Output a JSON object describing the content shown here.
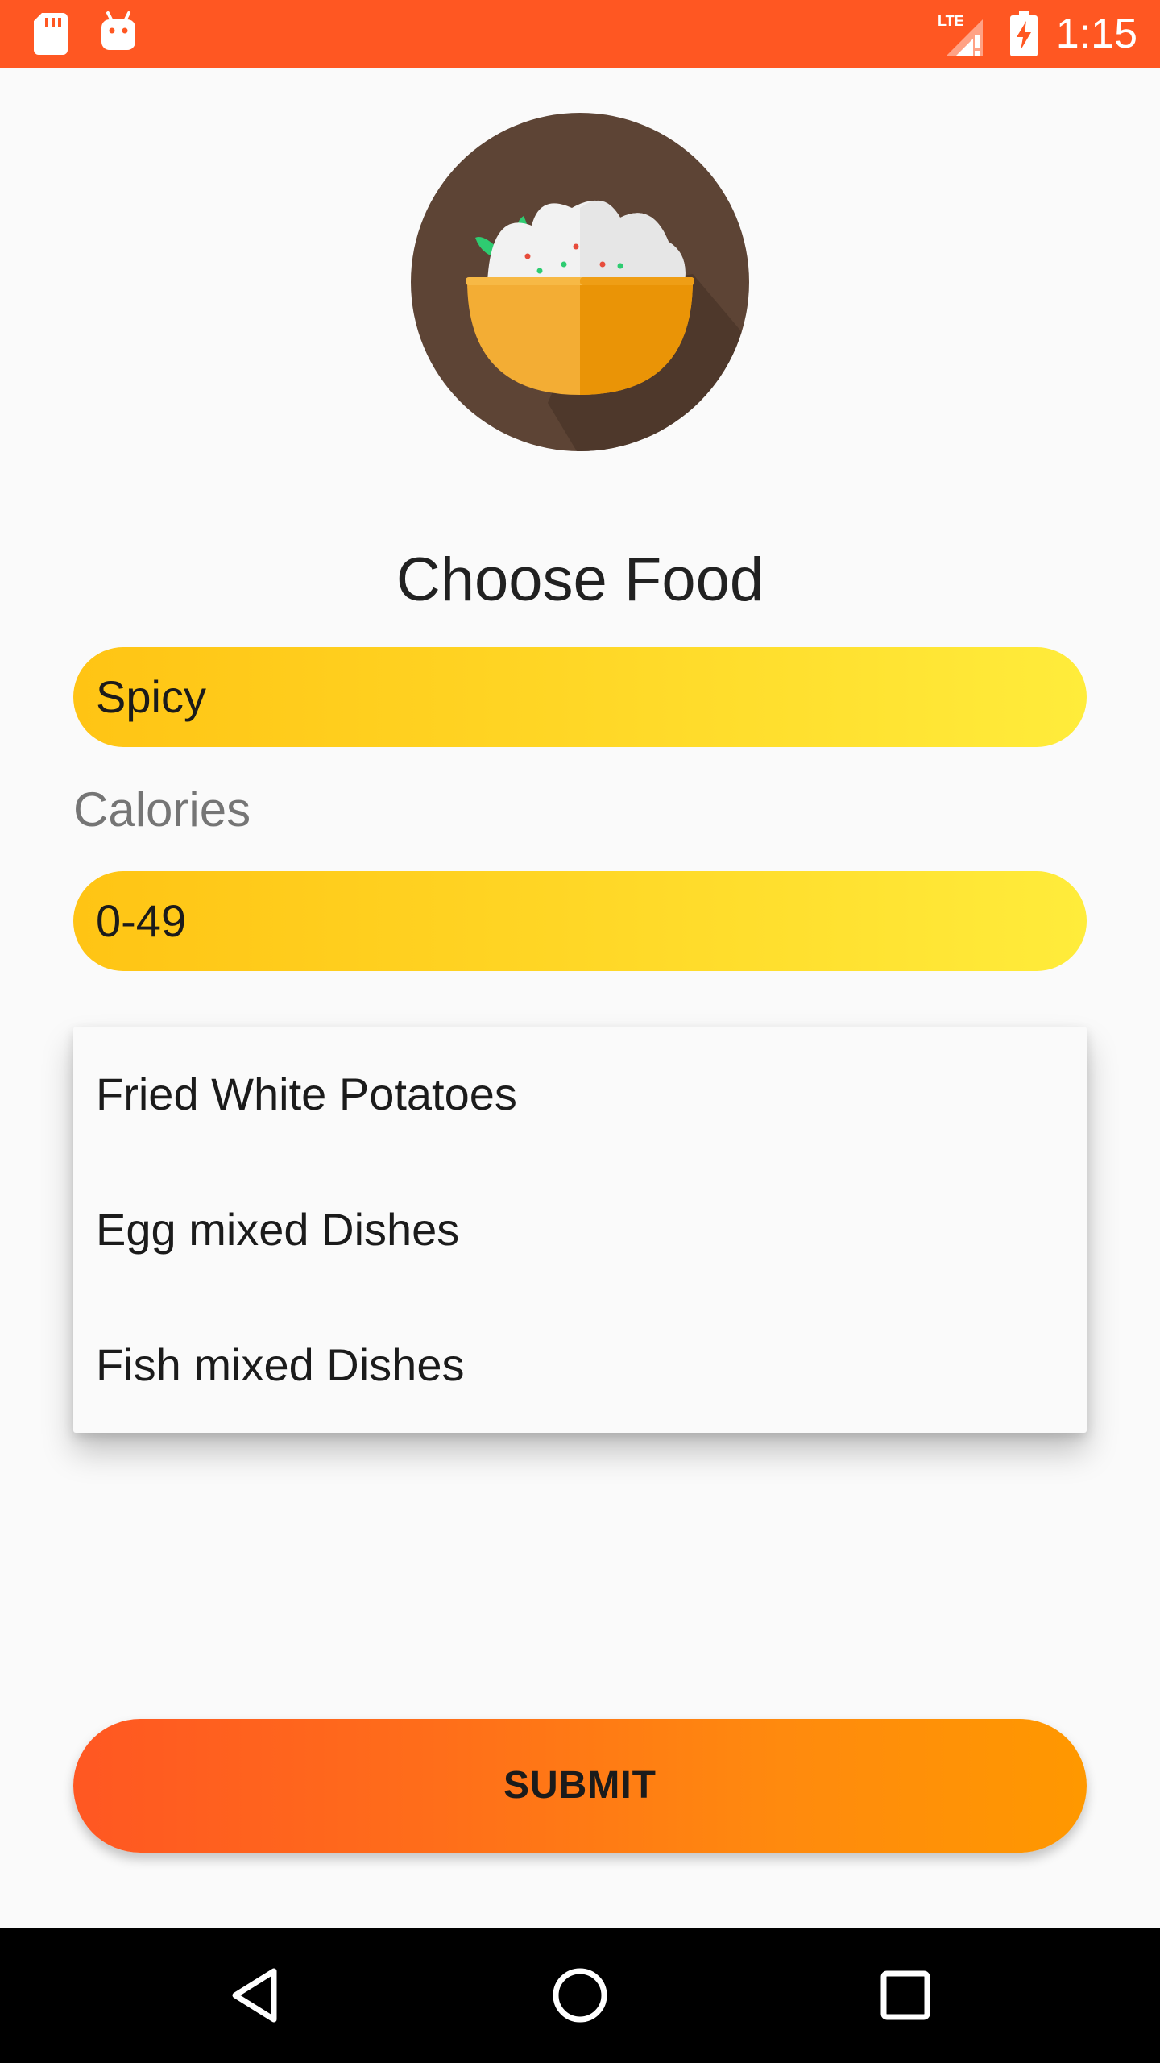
{
  "status_bar": {
    "time": "1:15",
    "network": "LTE",
    "icons": [
      "sd-card-icon",
      "android-icon",
      "signal-lte-icon",
      "battery-charging-icon"
    ],
    "background": "#ff5722"
  },
  "logo": {
    "icon": "food-bowl-icon"
  },
  "title": "Choose Food",
  "taste_select": {
    "value": "Spicy"
  },
  "calories": {
    "label": "Calories",
    "value": "0-49"
  },
  "dropdown": {
    "items": [
      {
        "label": "Fried White Potatoes"
      },
      {
        "label": "Egg mixed Dishes"
      },
      {
        "label": "Fish mixed Dishes"
      }
    ]
  },
  "submit": {
    "label": "SUBMIT"
  },
  "nav_bar": {
    "icons": [
      "back-icon",
      "home-icon",
      "recents-icon"
    ]
  },
  "colors": {
    "accent": "#ff5722",
    "pill_gradient_start": "#ffc414",
    "pill_gradient_end": "#ffec3b",
    "submit_gradient_end": "#ff9800"
  }
}
